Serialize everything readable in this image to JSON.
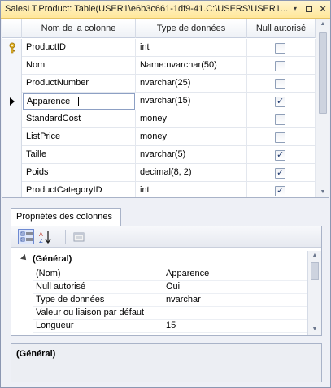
{
  "window": {
    "title": "SalesLT.Product: Table(USER1\\e6b3c661-1df9-41.C:\\USERS\\USER1...",
    "buttons": {
      "dropdown": "▾",
      "restore": "restore",
      "close": "✕"
    }
  },
  "grid": {
    "headers": [
      "Nom de la colonne",
      "Type de données",
      "Null autorisé"
    ],
    "rows": [
      {
        "name": "ProductID",
        "type": "int",
        "null_allowed": false,
        "is_key": true,
        "current": false
      },
      {
        "name": "Nom",
        "type": "Name:nvarchar(50)",
        "null_allowed": false,
        "is_key": false,
        "current": false
      },
      {
        "name": "ProductNumber",
        "type": "nvarchar(25)",
        "null_allowed": false,
        "is_key": false,
        "current": false
      },
      {
        "name": "Apparence",
        "type": "nvarchar(15)",
        "null_allowed": true,
        "is_key": false,
        "current": true
      },
      {
        "name": "StandardCost",
        "type": "money",
        "null_allowed": false,
        "is_key": false,
        "current": false
      },
      {
        "name": "ListPrice",
        "type": "money",
        "null_allowed": false,
        "is_key": false,
        "current": false
      },
      {
        "name": "Taille",
        "type": "nvarchar(5)",
        "null_allowed": true,
        "is_key": false,
        "current": false
      },
      {
        "name": "Poids",
        "type": "decimal(8, 2)",
        "null_allowed": true,
        "is_key": false,
        "current": false
      },
      {
        "name": "ProductCategoryID",
        "type": "int",
        "null_allowed": true,
        "is_key": false,
        "current": false
      }
    ]
  },
  "properties": {
    "tab_label": "Propriétés des colonnes",
    "toolbar": {
      "categorized_icon": "categorized-icon",
      "alphabetical_icon": "alphabetical-sort-icon",
      "property_pages_icon": "property-pages-icon"
    },
    "category": "(Général)",
    "rows": [
      {
        "name": "(Nom)",
        "value": "Apparence"
      },
      {
        "name": "Null autorisé",
        "value": "Oui"
      },
      {
        "name": "Type de données",
        "value": "nvarchar"
      },
      {
        "name": "Valeur ou liaison par défaut",
        "value": ""
      },
      {
        "name": "Longueur",
        "value": "15"
      }
    ],
    "description_title": "(Général)"
  },
  "colors": {
    "titlebar": "#ffe79a",
    "checkmark": "#203a6e",
    "selection_border": "#6e8ad2"
  }
}
